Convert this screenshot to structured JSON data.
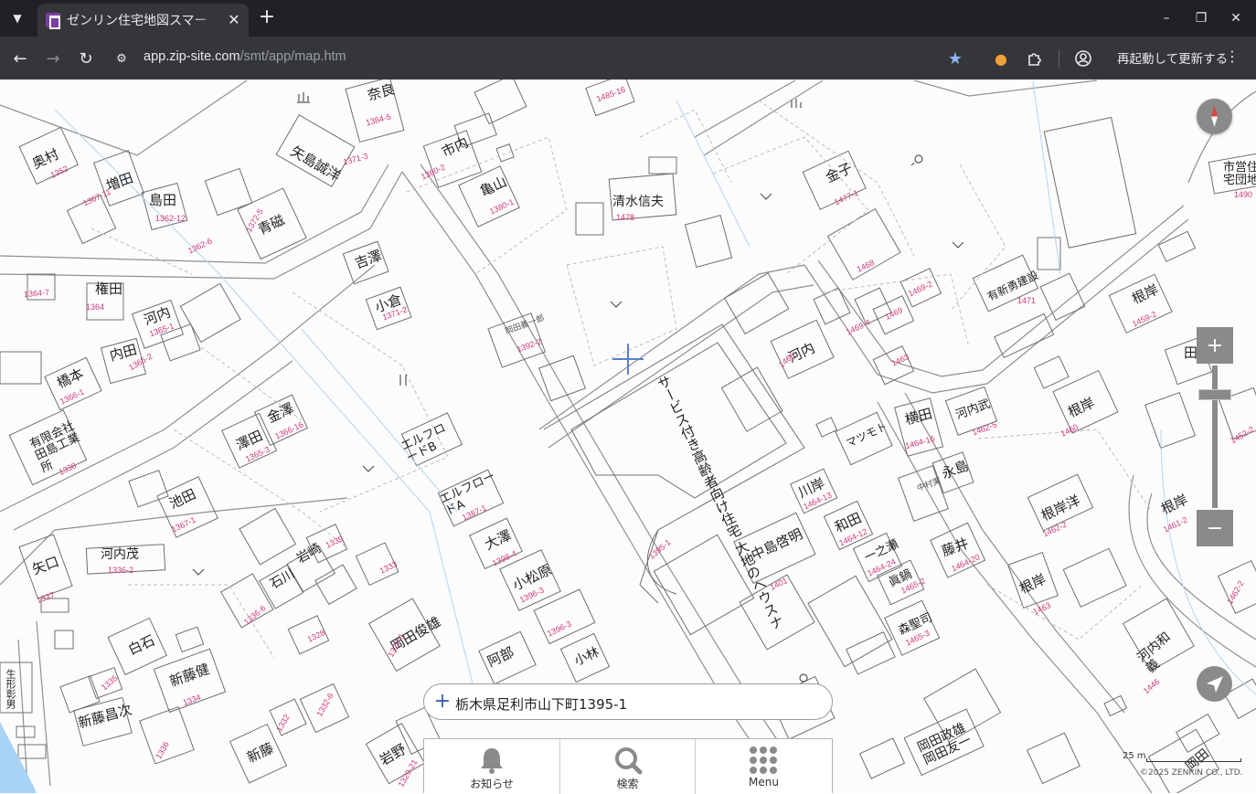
{
  "browser": {
    "tab_title": "ゼンリン住宅地図スマー",
    "url_host": "app.zip-site.com",
    "url_path": "/smt/app/map.htm",
    "restart_label": "再起動して更新する",
    "icons": [
      "tab-search-icon",
      "close-icon",
      "new-tab-icon",
      "minimize-icon",
      "restore-icon",
      "back-icon",
      "forward-icon",
      "reload-icon",
      "site-info-icon",
      "star-icon",
      "extension-icon",
      "puzzle-icon",
      "profile-icon",
      "more-icon"
    ]
  },
  "map": {
    "labels": {
      "l1": "奈良",
      "l2": "市内",
      "l3": "亀山",
      "l4": "清水信夫",
      "l5": "金子",
      "l6": "奥村",
      "l7": "増田",
      "l8": "島田",
      "l9": "青磁",
      "l10": "矢島誠洋",
      "l11": "権田",
      "l12": "河内",
      "l13": "内田",
      "l14": "吉澤",
      "l15": "小倉",
      "l16": "橋本",
      "l17": "有限会社田島工業所",
      "l18": "澤田",
      "l19": "金澤",
      "l20": "池田",
      "l21": "矢口",
      "l22": "河内茂",
      "l23": "石川",
      "l24": "岩崎",
      "l25": "白石",
      "l26": "新藤健",
      "l27": "新藤昌次",
      "l28": "新藤",
      "l29": "岡田俊雄",
      "l30": "阿部",
      "l31": "小林",
      "l32": "大澤",
      "l33": "小松原",
      "l34": "岩野",
      "l35": "エルフロードB",
      "l36": "エルフロードA",
      "l37": "サービス付き高齢者向け住宅 大地のヘウスナ",
      "l38": "河内",
      "l39": "川岸",
      "l40": "和田",
      "l41": "中島啓明",
      "l42": "マツモト",
      "l43": "横田",
      "l44": "河内武",
      "l45": "永島",
      "l46": "中村実",
      "l47": "一之瀬",
      "l48": "眞鍋",
      "l49": "森聖司",
      "l50": "藤井",
      "l51": "根岸",
      "l52": "根岸洋",
      "l53": "根岸",
      "l54": "根岸",
      "l55": "根岸",
      "l56": "有新勇建設",
      "l57": "市営住宅団地",
      "l58": "田島",
      "l59": "岡田政雄 岡田友一",
      "l60": "河内和義",
      "l61": "岡田",
      "l62": "生形彰男",
      "l63": "岡田義一郎"
    },
    "numbers": {
      "n1": "1371-3",
      "n2": "1380-2",
      "n3": "1380-1",
      "n4": "1478",
      "n5": "1477-1",
      "n6": "1352",
      "n7": "1367-11",
      "n8": "1362-12",
      "n9": "1372-5",
      "n10": "1362-6",
      "n11": "1364-7",
      "n12": "1364",
      "n13": "1365-1",
      "n14": "1365-2",
      "n15": "1371-2",
      "n16": "1366-1",
      "n17": "1338",
      "n18": "1365-3",
      "n19": "1366-16",
      "n20": "1367-1",
      "n21": "1337",
      "n22": "1336-2",
      "n23": "1336-6",
      "n24": "1333",
      "n25": "1339",
      "n26": "1334",
      "n27": "1335",
      "n28": "1336",
      "n29": "1332",
      "n30": "1332-6",
      "n31": "1328",
      "n32": "1327-1",
      "n33": "1329-21",
      "n34": "1392-2",
      "n35": "1387-1",
      "n36": "1398-4",
      "n37": "1396-3",
      "n38": "1396-3",
      "n39": "1395-1",
      "n40": "1466",
      "n41": "1401",
      "n42": "1464-16",
      "n43": "1464-13",
      "n44": "1464-12",
      "n45": "1464-24",
      "n46": "1465-2",
      "n47": "1465-3",
      "n48": "1464-20",
      "n49": "1469-4",
      "n50": "1469",
      "n51": "1469-2",
      "n52": "1468",
      "n53": "1463",
      "n54": "1471",
      "n55": "1459-2",
      "n56": "1462-5",
      "n57": "1460",
      "n58": "1462-2",
      "n59": "1461-2",
      "n60": "1463",
      "n61": "1485-16",
      "n62": "1490",
      "n63": "1462-2",
      "n64": "1446",
      "n65": "1452-2",
      "n66": "1384-5"
    }
  },
  "crosshair": "crosshair-icon",
  "controls": {
    "zoom_in": "+",
    "zoom_out": "−",
    "zoom_level_fraction": 0.18
  },
  "address": {
    "text": "栃木県足利市山下町1395-1"
  },
  "menu": {
    "items": [
      {
        "label": "お知らせ",
        "icon": "bell-icon"
      },
      {
        "label": "検索",
        "icon": "search-icon"
      },
      {
        "label": "Menu",
        "icon": "grid-icon"
      }
    ]
  },
  "scale": {
    "label": "25 m"
  },
  "copyright": "©2025 ZENRIN CO., LTD."
}
